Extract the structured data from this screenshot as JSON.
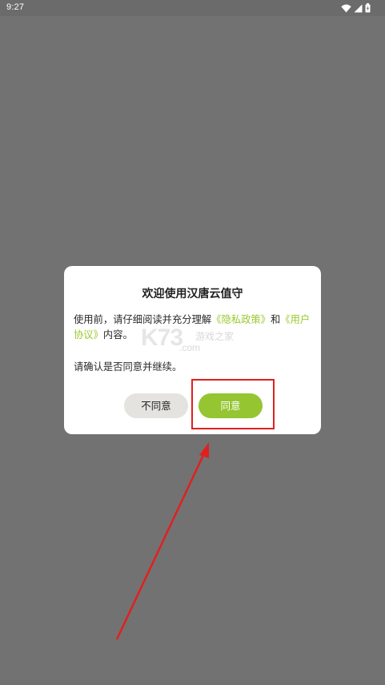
{
  "status_bar": {
    "time": "9:27",
    "icons": [
      "wifi-icon",
      "cellular-signal-icon",
      "battery-icon"
    ]
  },
  "dialog": {
    "title": "欢迎使用汉唐云值守",
    "message_prefix": "使用前，请仔细阅读并充分理解",
    "privacy_link": "《隐私政策》",
    "message_join": "和",
    "agreement_link": "《用户协议》",
    "message_suffix": "内容。",
    "confirm_text": "请确认是否同意并继续。",
    "disagree_label": "不同意",
    "agree_label": "同意"
  },
  "watermark": {
    "main": "K73",
    "sub": "游戏之家",
    "domain": ".com"
  },
  "colors": {
    "overlay": "#727272",
    "accent": "#95c531",
    "link": "#9bc82e",
    "annotation": "#e02020"
  }
}
